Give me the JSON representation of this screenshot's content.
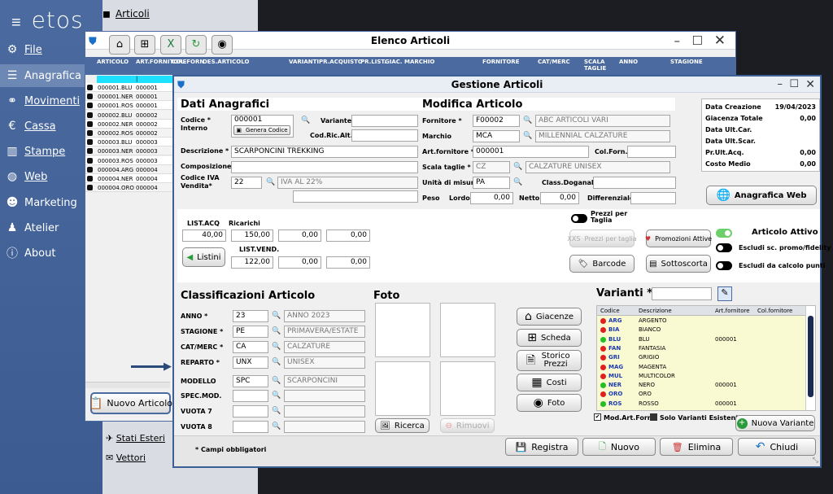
{
  "app": {
    "logo": "etos",
    "breadcrumb": "Articoli"
  },
  "sidebar": {
    "items": [
      {
        "label": "File",
        "icon": "gear-icon"
      },
      {
        "label": "Anagrafica",
        "icon": "database-icon"
      },
      {
        "label": "Movimenti",
        "icon": "group-icon"
      },
      {
        "label": "Cassa",
        "icon": "euro-icon"
      },
      {
        "label": "Stampe",
        "icon": "chart-icon"
      },
      {
        "label": "Web",
        "icon": "globe-icon"
      },
      {
        "label": "Marketing",
        "icon": "users-icon"
      },
      {
        "label": "Atelier",
        "icon": "figure-icon"
      },
      {
        "label": "About",
        "icon": "info-icon"
      }
    ]
  },
  "submenu": {
    "stati_esteri": "Stati Esteri",
    "vettori": "Vettori"
  },
  "elenco": {
    "title": "Elenco Articoli",
    "columns": [
      "ARTICOLO",
      "ART.FORNITORE",
      "COL.FORN",
      "DES.ARTICOLO",
      "VARIANTI",
      "PR.ACQUISTO",
      "PR.LIST.",
      "GIAC.",
      "MARCHIO",
      "FORNITORE",
      "CAT/MERC",
      "SCALA TAGLIE",
      "ANNO",
      "STAGIONE"
    ],
    "filter_value": "|",
    "rows": [
      [
        "000001.BLU",
        "000001"
      ],
      [
        "000001.NER",
        "000001"
      ],
      [
        "000001.ROS",
        "000001"
      ],
      [
        "000002.BLU",
        "000002"
      ],
      [
        "000002.NER",
        "000002"
      ],
      [
        "000002.ROS",
        "000002"
      ],
      [
        "000003.BLU",
        "000003"
      ],
      [
        "000003.NER",
        "000003"
      ],
      [
        "000003.ROS",
        "000003"
      ],
      [
        "000004.ARG",
        "000004"
      ],
      [
        "000004.NER",
        "000004"
      ],
      [
        "000004.ORO",
        "000004"
      ]
    ],
    "nuovo_articolo": "Nuovo Articolo"
  },
  "gestione": {
    "title": "Gestione Articoli",
    "dati_anagrafici": "Dati Anagrafici",
    "modifica_articolo": "Modifica Articolo",
    "codice_label": "Codice * Interno",
    "codice_value": "000001",
    "genera_codice": "Genera Codice",
    "variante_label": "Variante",
    "variante_value": "",
    "cod_ric_alt_label": "Cod.Ric.Alt.",
    "descrizione_label": "Descrizione *",
    "descrizione_value": "SCARPONCINI TREKKING",
    "composizione_label": "Composizione",
    "codice_iva_label": "Codice IVA Vendita*",
    "codice_iva_value": "22",
    "iva_desc": "IVA AL 22%",
    "fornitore_label": "Fornitore *",
    "fornitore_value": "F00002",
    "fornitore_desc": "ABC ARTICOLI VARI",
    "marchio_label": "Marchio",
    "marchio_value": "MCA",
    "marchio_desc": "MILLENNIAL CALZATURE",
    "art_fornitore_label": "Art.fornitore *",
    "art_fornitore_value": "000001",
    "col_forn_label": "Col.Forn.",
    "scala_taglie_label": "Scala taglie *",
    "scala_taglie_value": "CZ",
    "scala_taglie_desc": "CALZATURE UNISEX",
    "unita_misura_label": "Unità di misura",
    "unita_misura_value": "PA",
    "class_doganale_label": "Class.Doganale",
    "peso_label": "Peso",
    "lordo_label": "Lordo",
    "lordo_value": "0,00",
    "netto_label": "Netto",
    "netto_value": "0,00",
    "differenziale_label": "Differenziale",
    "info": {
      "data_creazione_label": "Data Creazione",
      "data_creazione_value": "19/04/2023",
      "giacenza_totale_label": "Giacenza Totale",
      "giacenza_totale_value": "0,00",
      "data_ult_car_label": "Data Ult.Car.",
      "data_ult_scar_label": "Data Ult.Scar.",
      "pr_ult_acq_label": "Pr.Ult.Acq.",
      "pr_ult_acq_value": "0,00",
      "costo_medio_label": "Costo Medio",
      "costo_medio_value": "0,00"
    },
    "anagrafica_web": "Anagrafica Web",
    "list_acq_label": "LIST.ACQ",
    "ricarichi_label": "Ricarichi",
    "list_acq_value": "40,00",
    "ricarichi_values": [
      "150,00",
      "0,00",
      "0,00"
    ],
    "list_vend_label": "LIST.VEND.",
    "list_vend_values": [
      "122,00",
      "0,00",
      "0,00"
    ],
    "listini": "Listini",
    "prezzi_per_taglia_toggle": "Prezzi per Taglia",
    "prezzi_per_taglia_btn": "Prezzi per taglia",
    "promozioni_attive": "Promozioni Attive",
    "barcode": "Barcode",
    "sottoscorta": "Sottoscorta",
    "articolo_attivo": "Articolo Attivo",
    "escludi_sc": "Escludi sc. promo/fidelity",
    "escludi_punti": "Escludi da calcolo punti",
    "classificazioni": "Classificazioni Articolo",
    "class_rows": [
      {
        "label": "ANNO *",
        "code": "23",
        "desc": "ANNO 2023"
      },
      {
        "label": "STAGIONE *",
        "code": "PE",
        "desc": "PRIMAVERA/ESTATE"
      },
      {
        "label": "CAT/MERC *",
        "code": "CA",
        "desc": "CALZATURE"
      },
      {
        "label": "REPARTO *",
        "code": "UNX",
        "desc": "UNISEX"
      },
      {
        "label": "MODELLO",
        "code": "SPC",
        "desc": "SCARPONCINI"
      },
      {
        "label": "SPEC.MOD.",
        "code": "",
        "desc": ""
      },
      {
        "label": "VUOTA 7",
        "code": "",
        "desc": ""
      },
      {
        "label": "VUOTA 8",
        "code": "",
        "desc": ""
      }
    ],
    "foto": "Foto",
    "ricerca": "Ricerca",
    "rimuovi": "Rimuovi",
    "side_buttons": [
      "Giacenze",
      "Scheda",
      "Storico Prezzi",
      "Costi",
      "Foto"
    ],
    "varianti_label": "Varianti *",
    "varianti_columns": [
      "Codice",
      "Descrizione",
      "Art.fornitore",
      "Col.fornitore"
    ],
    "varianti": [
      {
        "code": "ARG",
        "desc": "ARGENTO",
        "art": "",
        "color": "#e02020"
      },
      {
        "code": "BIA",
        "desc": "BIANCO",
        "art": "",
        "color": "#e02020"
      },
      {
        "code": "BLU",
        "desc": "BLU",
        "art": "000001",
        "color": "#22c022"
      },
      {
        "code": "FAN",
        "desc": "FANTASIA",
        "art": "",
        "color": "#e02020"
      },
      {
        "code": "GRI",
        "desc": "GRIGIO",
        "art": "",
        "color": "#e02020"
      },
      {
        "code": "MAG",
        "desc": "MAGENTA",
        "art": "",
        "color": "#e02020"
      },
      {
        "code": "MUL",
        "desc": "MULTICOLOR",
        "art": "",
        "color": "#e02020"
      },
      {
        "code": "NER",
        "desc": "NERO",
        "art": "000001",
        "color": "#22c022"
      },
      {
        "code": "ORO",
        "desc": "ORO",
        "art": "",
        "color": "#e02020"
      },
      {
        "code": "ROS",
        "desc": "ROSSO",
        "art": "000001",
        "color": "#22c022"
      }
    ],
    "mod_art_forn": "Mod.Art.Forn.",
    "solo_varianti": "Solo Varianti Esistenti",
    "nuova_variante": "Nuova Variante",
    "campi_obbligatori": "* Campi obbligatori",
    "registra": "Registra",
    "nuovo": "Nuovo",
    "elimina": "Elimina",
    "chiudi": "Chiudi"
  }
}
